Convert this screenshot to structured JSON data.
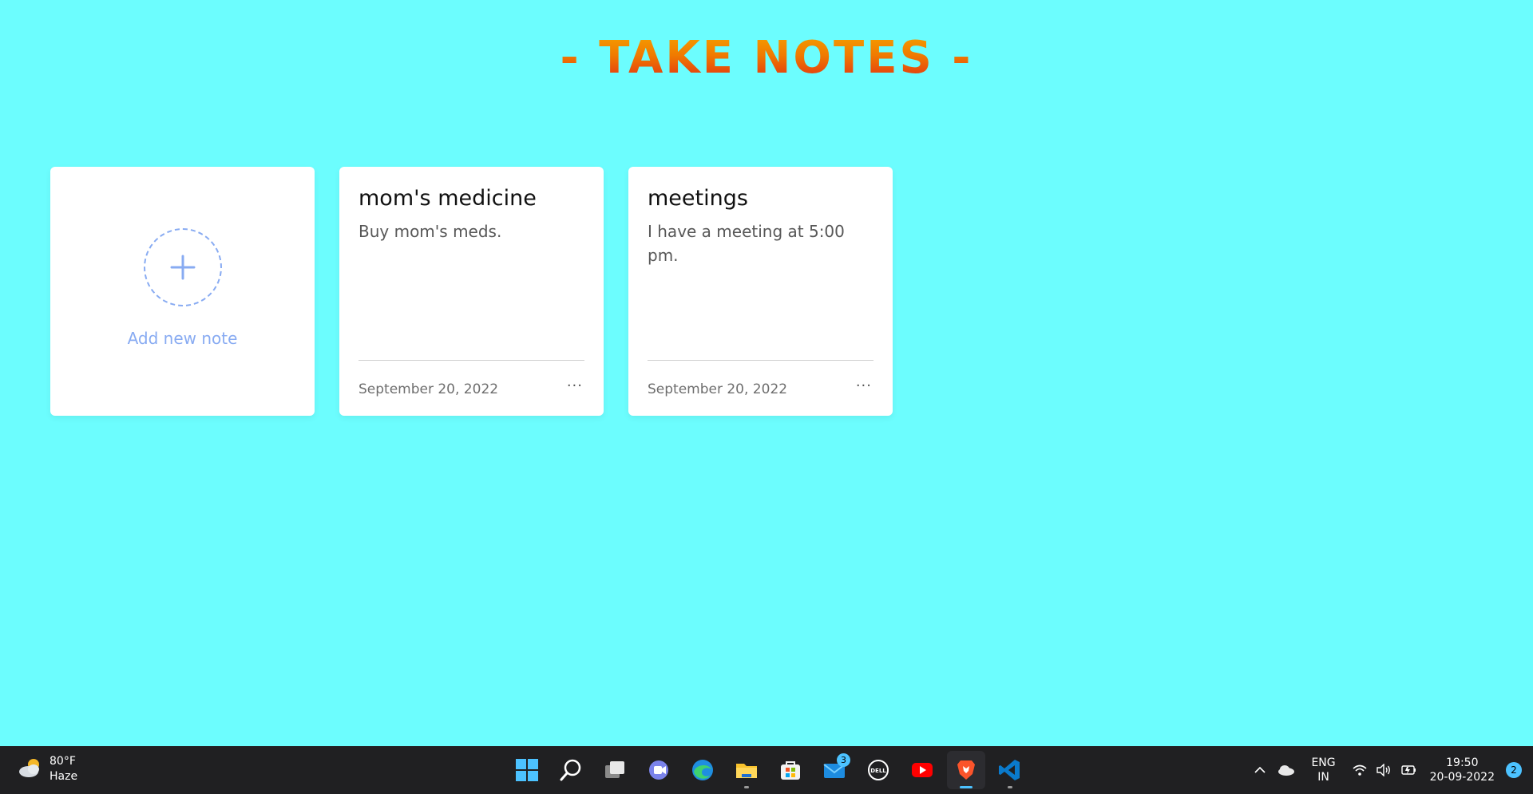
{
  "app": {
    "title": "- TAKE NOTES -"
  },
  "add_card": {
    "label": "Add new note",
    "icon": "plus-icon"
  },
  "notes": [
    {
      "title": "mom's medicine",
      "body": "Buy mom's meds.",
      "date": "September 20, 2022",
      "menu": "···"
    },
    {
      "title": "meetings",
      "body": "I have a meeting at 5:00 pm.",
      "date": "September 20, 2022",
      "menu": "···"
    }
  ],
  "colors": {
    "background": "#6cfdfe",
    "card": "#ffffff",
    "accent": "#88abf2",
    "title_gradient": [
      "#f5a300",
      "#f07a00",
      "#e02a14"
    ],
    "taskbar": "#202022"
  },
  "taskbar": {
    "weather": {
      "temp": "80°F",
      "condition": "Haze",
      "icon": "cloudy-sun-icon"
    },
    "apps": [
      {
        "name": "start",
        "icon": "windows-start-icon"
      },
      {
        "name": "search",
        "icon": "search-icon"
      },
      {
        "name": "task-view",
        "icon": "task-view-icon"
      },
      {
        "name": "teams-chat",
        "icon": "chat-icon"
      },
      {
        "name": "edge",
        "icon": "edge-browser-icon"
      },
      {
        "name": "file-explorer",
        "icon": "folder-icon"
      },
      {
        "name": "store",
        "icon": "store-icon"
      },
      {
        "name": "mail",
        "icon": "mail-icon",
        "badge": "3"
      },
      {
        "name": "dell",
        "icon": "dell-icon"
      },
      {
        "name": "youtube",
        "icon": "youtube-icon"
      },
      {
        "name": "brave",
        "icon": "brave-browser-icon"
      },
      {
        "name": "vscode",
        "icon": "vscode-icon"
      }
    ],
    "tray": {
      "language_line1": "ENG",
      "language_line2": "IN",
      "time": "19:50",
      "date": "20-09-2022",
      "notifications": "2"
    }
  }
}
